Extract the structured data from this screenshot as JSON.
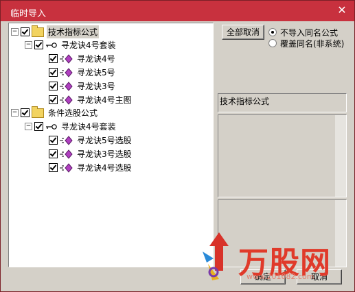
{
  "window": {
    "title": "临时导入",
    "close_glyph": "✕"
  },
  "tree": [
    {
      "label": "技术指标公式",
      "type": "folder",
      "expander": "−",
      "checked": true,
      "selected": true
    },
    {
      "label": "寻龙诀4号套装",
      "type": "key",
      "expander": "−",
      "checked": true
    },
    {
      "label": "寻龙诀4号",
      "type": "formula",
      "checked": true
    },
    {
      "label": "寻龙诀5号",
      "type": "formula",
      "checked": true
    },
    {
      "label": "寻龙诀3号",
      "type": "formula",
      "checked": true
    },
    {
      "label": "寻龙诀4号主图",
      "type": "formula",
      "checked": true
    },
    {
      "label": "条件选股公式",
      "type": "folder",
      "expander": "−",
      "checked": true
    },
    {
      "label": "寻龙诀4号套装",
      "type": "key",
      "expander": "−",
      "checked": true
    },
    {
      "label": "寻龙诀5号选股",
      "type": "formula",
      "checked": true
    },
    {
      "label": "寻龙诀3号选股",
      "type": "formula",
      "checked": true
    },
    {
      "label": "寻龙诀4号选股",
      "type": "formula",
      "checked": true
    }
  ],
  "buttons": {
    "cancel_all": "全部取消",
    "ok": "确定",
    "cancel": "取消"
  },
  "options": [
    {
      "label": "不导入同名公式",
      "selected": true
    },
    {
      "label": "覆盖同名(非系统)",
      "selected": false
    }
  ],
  "detail": {
    "category_label": "技术指标公式"
  },
  "watermark": {
    "text": "万股网",
    "url": "www.201082.com"
  },
  "colors": {
    "titlebar": "#c8313e",
    "panel": "#d4d0c8",
    "watermark": "#e03a2a"
  }
}
